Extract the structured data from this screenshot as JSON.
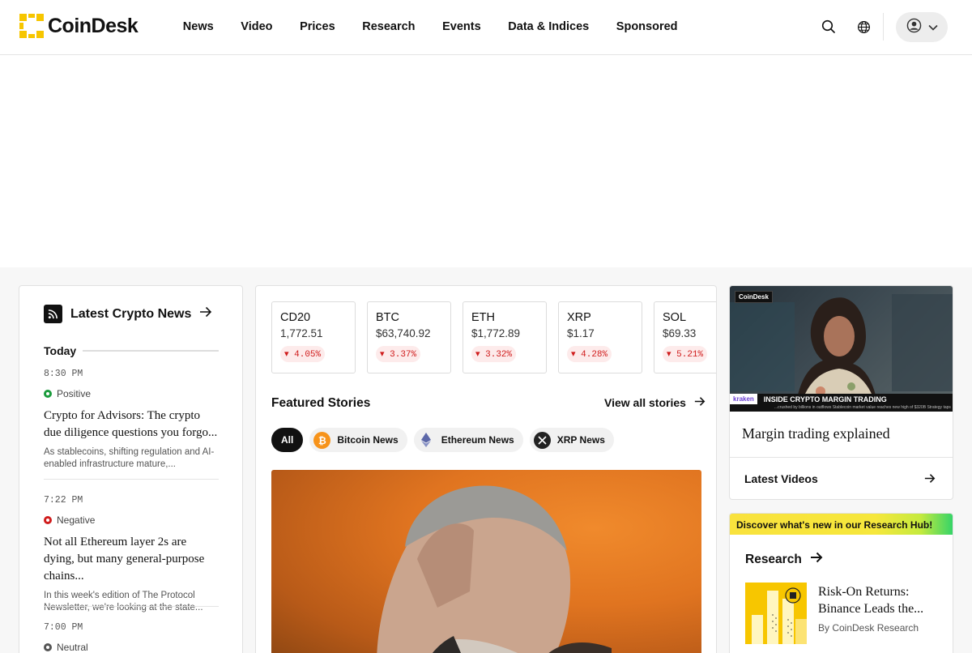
{
  "header": {
    "logo_text": "CoinDesk",
    "nav": [
      "News",
      "Video",
      "Prices",
      "Research",
      "Events",
      "Data & Indices",
      "Sponsored"
    ]
  },
  "latest_news": {
    "title": "Latest Crypto News",
    "day_label": "Today",
    "items": [
      {
        "time": "8:30 PM",
        "sentiment": "Positive",
        "sentiment_color": "#1a9b3c",
        "headline": "Crypto for Advisors: The crypto due diligence questions you forgo...",
        "summary": "As stablecoins, shifting regulation and AI-enabled infrastructure mature,..."
      },
      {
        "time": "7:22 PM",
        "sentiment": "Negative",
        "sentiment_color": "#d01c1c",
        "headline": "Not all Ethereum layer 2s are dying, but many general-purpose chains...",
        "summary": "In this week's edition of The Protocol Newsletter, we're looking at the state..."
      },
      {
        "time": "7:00 PM",
        "sentiment": "Neutral",
        "sentiment_color": "#555555"
      }
    ]
  },
  "tickers": [
    {
      "symbol": "CD20",
      "price": "1,772.51",
      "change": "4.05%"
    },
    {
      "symbol": "BTC",
      "price": "$63,740.92",
      "change": "3.37%"
    },
    {
      "symbol": "ETH",
      "price": "$1,772.89",
      "change": "3.32%"
    },
    {
      "symbol": "XRP",
      "price": "$1.17",
      "change": "4.28%"
    },
    {
      "symbol": "SOL",
      "price": "$69.33",
      "change": "5.21%"
    }
  ],
  "featured": {
    "title": "Featured Stories",
    "view_all": "View all stories",
    "filters": [
      "All",
      "Bitcoin News",
      "Ethereum News",
      "XRP News"
    ]
  },
  "video": {
    "logo": "CoinDesk",
    "banner_brand": "kraken",
    "banner_text": "INSIDE CRYPTO MARGIN TRADING",
    "banner_subtext": "...crushed by billions in outflows   Stablecoin market value reaches new high of $320B   Strategy taps",
    "title": "Margin trading explained",
    "latest_label": "Latest Videos"
  },
  "research": {
    "banner": "Discover what's new in our Research Hub!",
    "title": "Research",
    "headline": "Risk-On Returns: Binance Leads the...",
    "byline": "By CoinDesk Research"
  },
  "colors": {
    "brand": "#f7c600",
    "negative": "#d01c1c",
    "positive": "#1a9b3c"
  }
}
